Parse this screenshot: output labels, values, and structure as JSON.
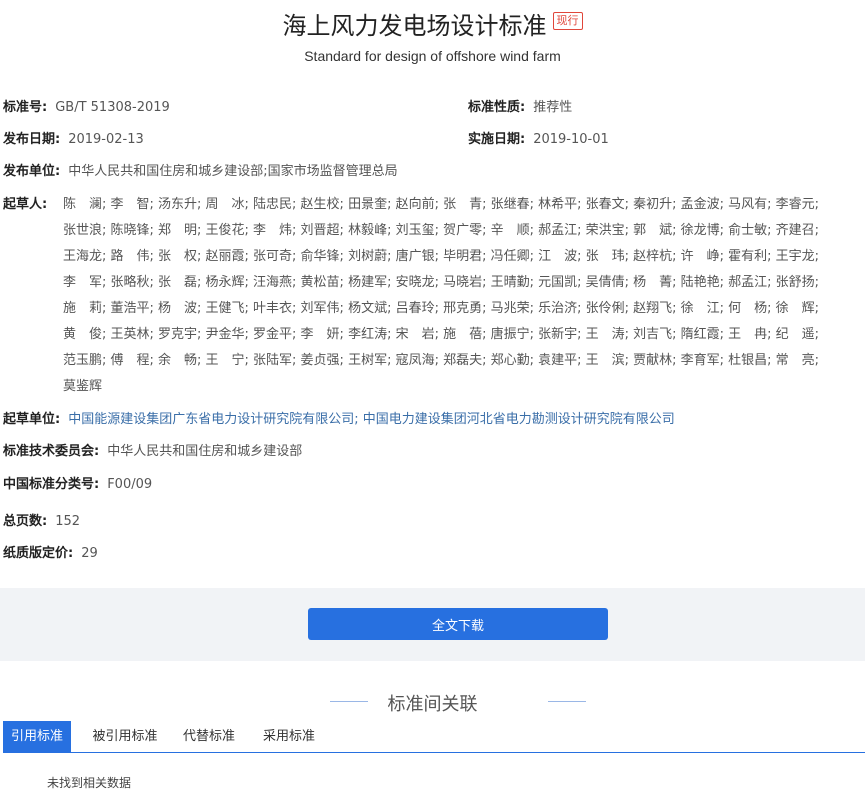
{
  "title": "海上风力发电场设计标准",
  "status_badge": "现行",
  "subtitle": "Standard for design of offshore wind farm",
  "fields": {
    "std_no_label": "标准号:",
    "std_no": "GB/T 51308-2019",
    "nature_label": "标准性质:",
    "nature": "推荐性",
    "pub_date_label": "发布日期:",
    "pub_date": "2019-02-13",
    "impl_date_label": "实施日期:",
    "impl_date": "2019-10-01",
    "publisher_label": "发布单位:",
    "publisher": "中华人民共和国住房和城乡建设部;国家市场监督管理总局",
    "drafters_label": "起草人:",
    "drafters_lines": [
      "陈　澜; 李　智; 汤东升; 周　冰; 陆忠民; 赵生校; 田景奎; 赵向前; 张　青; 张继春; 林希平; 张春文; 秦初升; 孟金波; 马风有; 李睿元;",
      "张世浪; 陈晓锋; 郑　明; 王俊花; 李　炜; 刘晋超; 林毅峰; 刘玉玺; 贺广零; 辛　顺; 郝孟江; 荣洪宝; 郭　斌; 徐龙博; 俞士敏; 齐建召;",
      "王海龙; 路　伟; 张　权; 赵丽霞; 张可奇; 俞华锋; 刘树蔚; 唐广银; 毕明君; 冯任卿; 江　波; 张　玮; 赵梓杭; 许　峥; 霍有利; 王宇龙;",
      "李　军; 张略秋; 张　磊; 杨永辉; 汪海燕; 黄松苗; 杨建军; 安晓龙; 马晓岩; 王晴勤; 元国凯; 吴倩倩; 杨　菁; 陆艳艳; 郝孟江; 张舒扬;",
      "施　莉; 董浩平; 杨　波; 王健飞; 叶丰衣; 刘军伟; 杨文斌; 吕春玲; 邢克勇; 马兆荣; 乐治济; 张伶俐; 赵翔飞; 徐　江; 何　杨; 徐　辉;",
      "黄　俊; 王英林; 罗克宇; 尹金华; 罗金平; 李　妍; 李红涛; 宋　岩; 施　蓓; 唐振宁; 张新宇; 王　涛; 刘吉飞; 隋红霞; 王　冉; 纪　遥;",
      "范玉鹏; 傅　程; 余　畅; 王　宁; 张陆军; 姜贞强; 王树军; 寇凤海; 郑磊夫; 郑心勤; 袁建平; 王　滨; 贾献林; 李育军; 杜银昌; 常　亮;",
      "莫鉴辉"
    ],
    "draft_org_label": "起草单位:",
    "draft_org": "中国能源建设集团广东省电力设计研究院有限公司; 中国电力建设集团河北省电力勘测设计研究院有限公司",
    "committee_label": "标准技术委员会:",
    "committee": "中华人民共和国住房和城乡建设部",
    "ccs_label": "中国标准分类号:",
    "ccs": "F00/09",
    "pages_label": "总页数:",
    "pages": "152",
    "price_label": "纸质版定价:",
    "price": "29"
  },
  "download_label": "全文下载",
  "related_title": "标准间关联",
  "tabs": [
    {
      "label": "引用标准",
      "active": true
    },
    {
      "label": "被引用标准",
      "active": false
    },
    {
      "label": "代替标准",
      "active": false
    },
    {
      "label": "采用标准",
      "active": false
    }
  ],
  "empty_note": "未找到相关数据",
  "colors": {
    "accent": "#2770e0",
    "badge": "#e0463a",
    "link": "#3a6ea8",
    "band": "#f1f3f6"
  }
}
